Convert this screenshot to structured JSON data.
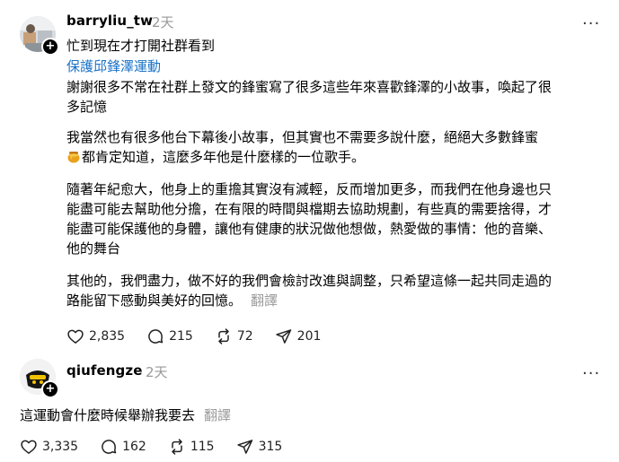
{
  "post1": {
    "username": "barryliu_tw",
    "time": "2天",
    "more_label": "···",
    "follow_badge": "+",
    "line1": "忙到現在才打開社群看到",
    "hashtag": "保護邱鋒澤運動",
    "para1_l1": "謝謝很多不常在社群上發文的鋒蜜寫了很多這些年來喜歡鋒澤的小故事，喚起了很",
    "para1_l2": "多記憶",
    "para2_l1": "我當然也有很多他台下幕後小故事，但其實也不需要多說什麼，絕絕大多數鋒蜜",
    "para2_l2": "都肯定知道，這麼多年他是什麼樣的一位歌手。",
    "para3_l1": "隨著年紀愈大，他身上的重擔其實沒有減輕，反而增加更多，而我們在他身邊也只",
    "para3_l2": "能盡可能去幫助他分擔，在有限的時間與檔期去協助規劃，有些真的需要捨得，才",
    "para3_l3": "能盡可能保護他的身體，讓他有健康的狀況做他想做，熱愛做的事情：他的音樂、",
    "para3_l4": "他的舞台",
    "para4_l1": "其他的，我們盡力，做不好的我們會檢討改進與調整，只希望這條一起共同走過的",
    "para4_l2": "路能留下感動與美好的回憶。",
    "translate": "翻譯",
    "likes": "2,835",
    "comments": "215",
    "reposts": "72",
    "shares": "201"
  },
  "post2": {
    "username": "qiufengze",
    "time": "2天",
    "more_label": "···",
    "follow_badge": "+",
    "text": "這運動會什麼時候舉辦我要去",
    "translate": "翻譯",
    "likes": "3,335",
    "comments": "162",
    "reposts": "115",
    "shares": "315"
  }
}
